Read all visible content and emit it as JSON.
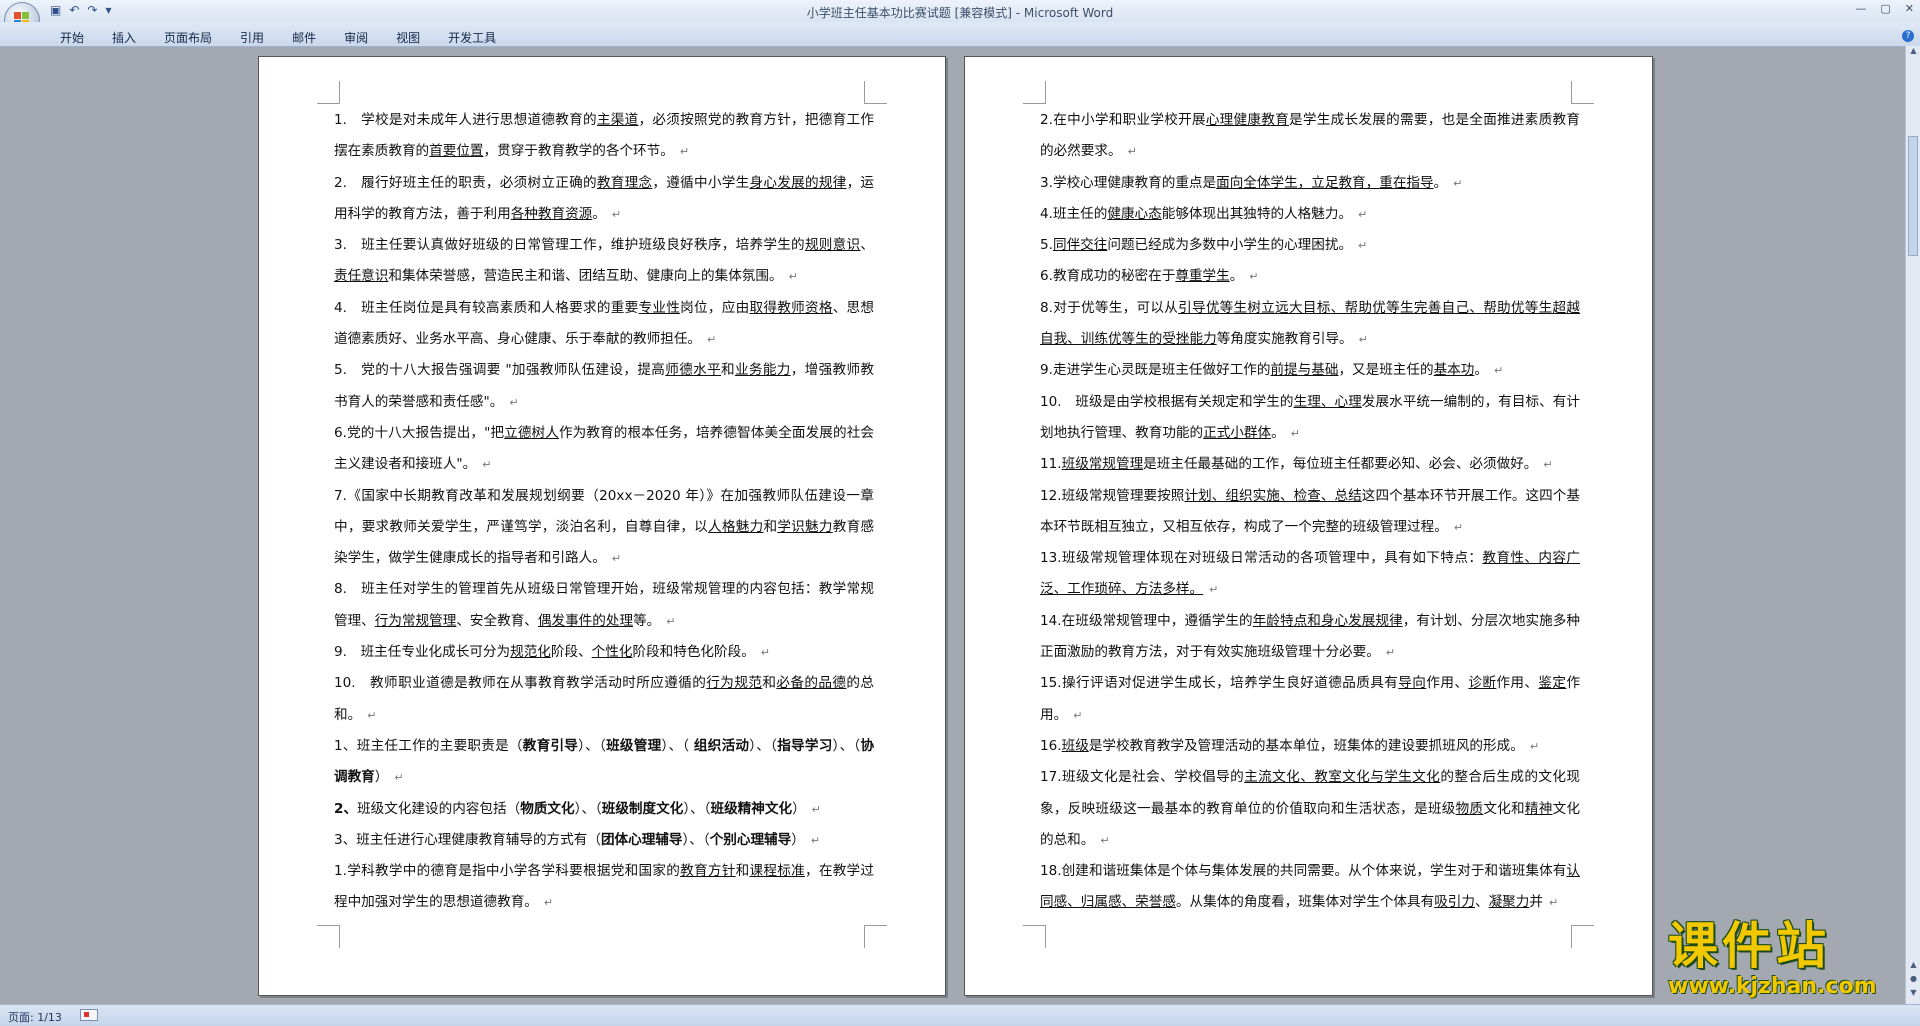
{
  "window": {
    "title": "小学班主任基本功比赛试题 [兼容模式] - Microsoft Word"
  },
  "qat": {
    "undo": "↶",
    "redo": "↷"
  },
  "ribbon": {
    "tabs": [
      "开始",
      "插入",
      "页面布局",
      "引用",
      "邮件",
      "审阅",
      "视图",
      "开发工具"
    ]
  },
  "status": {
    "page": "页面: 1/13"
  },
  "watermark": {
    "name": "课件站",
    "url": "www.kjzhan.com"
  },
  "colors": {
    "title_text": "#3d4d6a",
    "ribbon_bg": "#cbd9ec",
    "workspace": "#a3a8b1",
    "watermark": "#f2c800"
  },
  "page1": [
    "1.　学校是对未成年人进行思想道德教育的<u>主渠道</u>，必须按照党的教育方针，把德育工作摆在素质教育的<u>首要位置</u>，贯穿于教育教学的各个环节。",
    "2.　履行好班主任的职责，必须树立正确的<u>教育理念</u>，遵循中小学生<u>身心发展的规律</u>，运用科学的教育方法，善于利用<u>各种教育资源</u>。",
    "3.　班主任要认真做好班级的日常管理工作，维护班级良好秩序，培养学生的<u>规则意识</u>、<u>责任意识</u>和集体荣誉感，营造民主和谐、团结互助、健康向上的集体氛围。",
    "4.　班主任岗位是具有较高素质和人格要求的重要<u>专业性</u>岗位，应由<u>取得教师资格</u>、思想道德素质好、业务水平高、身心健康、乐于奉献的教师担任。",
    "5.　党的十八大报告强调要 \"加强教师队伍建设，提高<u>师德水平</u>和<u>业务能力</u>，增强教师教书育人的荣誉感和责任感\"。",
    "6.党的十八大报告提出，\"把<u>立德树人</u>作为教育的根本任务，培养德智体美全面发展的社会主义建设者和接班人\"。",
    "7.《国家中长期教育改革和发展规划纲要（20xx－2020 年）》在加强教师队伍建设一章中，要求教师关爱学生，严谨笃学，淡泊名利，自尊自律，以<u>人格魅力</u>和<u>学识魅力</u>教育感染学生，做学生健康成长的指导者和引路人。",
    "8.　班主任对学生的管理首先从班级日常管理开始，班级常规管理的内容包括：教学常规管理、<u>行为常规管理</u>、安全教育、<u>偶发事件的处理</u>等。",
    "9.　班主任专业化成长可分为<u>规范化</u>阶段、<u>个性化</u>阶段和特色化阶段。",
    "10.　教师职业道德是教师在从事教育教学活动时所应遵循的<u>行为规范</u>和<u>必备的品德</u>的总和。",
    "1、班主任工作的主要职责是（<b>教育引导</b>）、（<b>班级管理</b>）、（ <b>组织活动</b>）、（<b>指导学习</b>）、（<b>协调教育</b>）",
    "<b>2、</b>班级文化建设的内容包括（<b>物质文化</b>）、（<b>班级制度文化</b>）、（<b>班级精神文化</b>）",
    "3、班主任进行心理健康教育辅导的方式有（<b>团体心理辅导</b>）、（<b>个别心理辅导</b>）",
    "1.学科教学中的德育是指中小学各学科要根据党和国家的<u>教育方针</u>和<u>课程标准</u>，在教学过程中加强对学生的思想道德教育。"
  ],
  "page2": [
    "2.在中小学和职业学校开展<u>心理健康教育</u>是学生成长发展的需要，也是全面推进素质教育的必然要求。",
    "3.学校心理健康教育的重点是<u>面向全体学生，立足教育，重在指导</u>。",
    "4.班主任的<u>健康心态</u>能够体现出其独特的人格魅力。",
    "5.<u>同伴交往</u>问题已经成为多数中小学生的心理困扰。",
    "6.教育成功的秘密在于<u>尊重学生</u>。",
    "8.对于优等生，可以从<u>引导优等生树立远大目标、帮助优等生完善自己、帮助优等生超越自我、训练优等生的受挫能力</u>等角度实施教育引导。",
    "9.走进学生心灵既是班主任做好工作的<u>前提与基础</u>，又是班主任的<u>基本功</u>。",
    "10.　班级是由学校根据有关规定和学生的<u>生理、心理</u>发展水平统一编制的，有目标、有计划地执行管理、教育功能的<u>正式小群体</u>。",
    "11.<u>班级常规管理</u>是班主任最基础的工作，每位班主任都要必知、必会、必须做好。",
    "12.班级常规管理要按照<u>计划、组织实施、检查、总结</u>这四个基本环节开展工作。这四个基本环节既相互独立，又相互依存，构成了一个完整的班级管理过程。",
    "13.班级常规管理体现在对班级日常活动的各项管理中，具有如下特点：<u>教育性、内容广泛、工作琐碎、方法多样。</u>",
    "14.在班级常规管理中，遵循学生的<u>年龄特点和身心发展规律</u>，有计划、分层次地实施多种正面激励的教育方法，对于有效实施班级管理十分必要。",
    "15.操行评语对促进学生成长，培养学生良好道德品质具有<u>导向</u>作用、<u>诊断</u>作用、<u>鉴定</u>作用。",
    "16.<u>班级</u>是学校教育教学及管理活动的基本单位，班集体的建设要抓班风的形成。",
    "17.班级文化是社会、学校倡导的<u>主流文化、教室文化与学生文化</u>的整合后生成的文化现象，反映班级这一最基本的教育单位的价值取向和生活状态，是班级<u>物质</u>文化和<u>精神</u>文化的总和。",
    "18.创建和谐班集体是个体与集体发展的共同需要。从个体来说，学生对于和谐班集体有<u>认同感、归属感、荣誉感</u>。从集体的角度看，班集体对学生个体具有<u>吸引力</u>、<u>凝聚力</u>并"
  ]
}
